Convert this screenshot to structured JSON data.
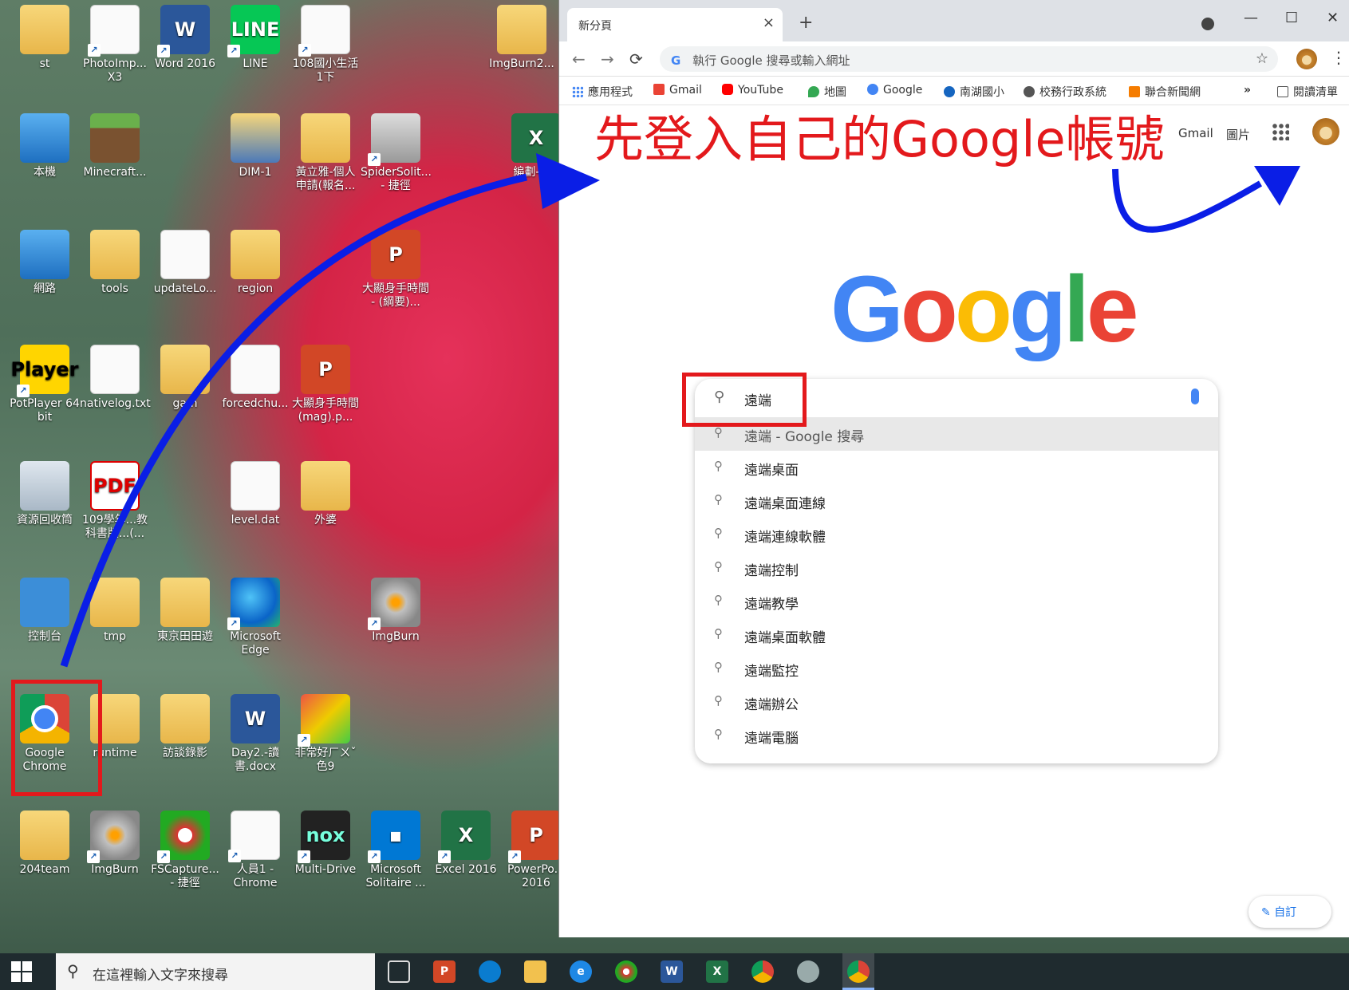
{
  "desktop": {
    "icons": [
      {
        "label": "st",
        "glyph": "person-folder-icon"
      },
      {
        "label": "PhotoImp... X3",
        "glyph": "photoimpact-icon"
      },
      {
        "label": "Word 2016",
        "glyph": "word-icon"
      },
      {
        "label": "LINE",
        "glyph": "line-icon"
      },
      {
        "label": "108國小生活1下",
        "glyph": "document-icon"
      },
      {
        "label": "ImgBurn2...",
        "glyph": "folder-icon"
      },
      {
        "label": "本機",
        "glyph": "computer-icon"
      },
      {
        "label": "Minecraft...",
        "glyph": "minecraft-icon"
      },
      {
        "label": "DIM-1",
        "glyph": "film-folder-icon"
      },
      {
        "label": "黃立雅-個人申請(報名...",
        "glyph": "folder-icon"
      },
      {
        "label": "SpiderSolit... - 捷徑",
        "glyph": "spider-solitaire-icon"
      },
      {
        "label": "網路",
        "glyph": "network-icon"
      },
      {
        "label": "tools",
        "glyph": "folder-icon"
      },
      {
        "label": "updateLo...",
        "glyph": "document-icon"
      },
      {
        "label": "region",
        "glyph": "folder-icon"
      },
      {
        "label": "大顯身手時間 - (綱要)...",
        "glyph": "powerpoint-icon"
      },
      {
        "label": "PotPlayer 64 bit",
        "glyph": "potplayer-icon"
      },
      {
        "label": "nativelog.txt",
        "glyph": "document-icon"
      },
      {
        "label": "gam",
        "glyph": "folder-icon"
      },
      {
        "label": "forcedchu...",
        "glyph": "document-icon"
      },
      {
        "label": "大顯身手時間(mag).p...",
        "glyph": "powerpoint-icon"
      },
      {
        "label": "資源回收筒",
        "glyph": "recycle-bin-icon"
      },
      {
        "label": "109學年...教科書版...(...",
        "glyph": "pdf-icon"
      },
      {
        "label": "level.dat",
        "glyph": "document-icon"
      },
      {
        "label": "外婆",
        "glyph": "folder-icon"
      },
      {
        "label": "控制台",
        "glyph": "control-panel-icon"
      },
      {
        "label": "tmp",
        "glyph": "folder-icon"
      },
      {
        "label": "東京田田遊",
        "glyph": "folder-icon"
      },
      {
        "label": "Microsoft Edge",
        "glyph": "edge-icon"
      },
      {
        "label": "ImgBurn",
        "glyph": "imgburn-icon"
      },
      {
        "label": "Google Chrome",
        "glyph": "chrome-icon"
      },
      {
        "label": "runtime",
        "glyph": "folder-icon"
      },
      {
        "label": "訪談錄影",
        "glyph": "folder-icon"
      },
      {
        "label": "Day2.-讀書.docx",
        "glyph": "word-icon"
      },
      {
        "label": "非常好ㄏㄨˇ色9",
        "glyph": "book-icon"
      },
      {
        "label": "204team",
        "glyph": "folder-icon"
      },
      {
        "label": "ImgBurn",
        "glyph": "imgburn-icon"
      },
      {
        "label": "FSCapture... - 捷徑",
        "glyph": "fscapture-icon"
      },
      {
        "label": "人員1 - Chrome",
        "glyph": "document-icon"
      },
      {
        "label": "Multi-Drive",
        "glyph": "nox-icon"
      },
      {
        "label": "Microsoft Solitaire ...",
        "glyph": "solitaire-icon"
      },
      {
        "label": "Excel 2016",
        "glyph": "excel-icon"
      },
      {
        "label": "PowerPo... 2016",
        "glyph": "powerpoint-icon"
      },
      {
        "label": "編劃---報",
        "glyph": "excel-icon"
      }
    ]
  },
  "browser": {
    "tab_title": "新分頁",
    "omnibox_placeholder": "執行 Google 搜尋或輸入網址",
    "bookmarks": [
      "應用程式",
      "Gmail",
      "YouTube",
      "地圖",
      "Google",
      "南湖國小",
      "校務行政系統",
      "聯合新聞網"
    ],
    "reading_list": "閱讀清單",
    "more_bookmarks": "»",
    "annotation": "先登入自己的Google帳號",
    "top_links": {
      "gmail": "Gmail",
      "images": "圖片"
    },
    "logo_letters": [
      {
        "char": "G",
        "color": "#4285F4"
      },
      {
        "char": "o",
        "color": "#EA4335"
      },
      {
        "char": "o",
        "color": "#FBBC05"
      },
      {
        "char": "g",
        "color": "#4285F4"
      },
      {
        "char": "l",
        "color": "#34A853"
      },
      {
        "char": "e",
        "color": "#EA4335"
      }
    ],
    "search_value": "遠端",
    "suggestions": [
      "遠端 - Google 搜尋",
      "遠端桌面",
      "遠端桌面連線",
      "遠端連線軟體",
      "遠端控制",
      "遠端教學",
      "遠端桌面軟體",
      "遠端監控",
      "遠端辦公",
      "遠端電腦"
    ],
    "customize_label": "自訂"
  },
  "taskbar": {
    "search_placeholder": "在這裡輸入文字來搜尋",
    "apps": [
      "task-view-icon",
      "powerpoint-icon",
      "edge-icon",
      "file-explorer-icon",
      "internet-explorer-icon",
      "fscapture-icon",
      "word-icon",
      "excel-icon",
      "chrome-icon",
      "settings-icon",
      "chrome-active-icon"
    ]
  },
  "colors": {
    "annotation_red": "#E3191C",
    "arrow_blue": "#0A1EE6",
    "chrome_blue": "#4285F4"
  }
}
